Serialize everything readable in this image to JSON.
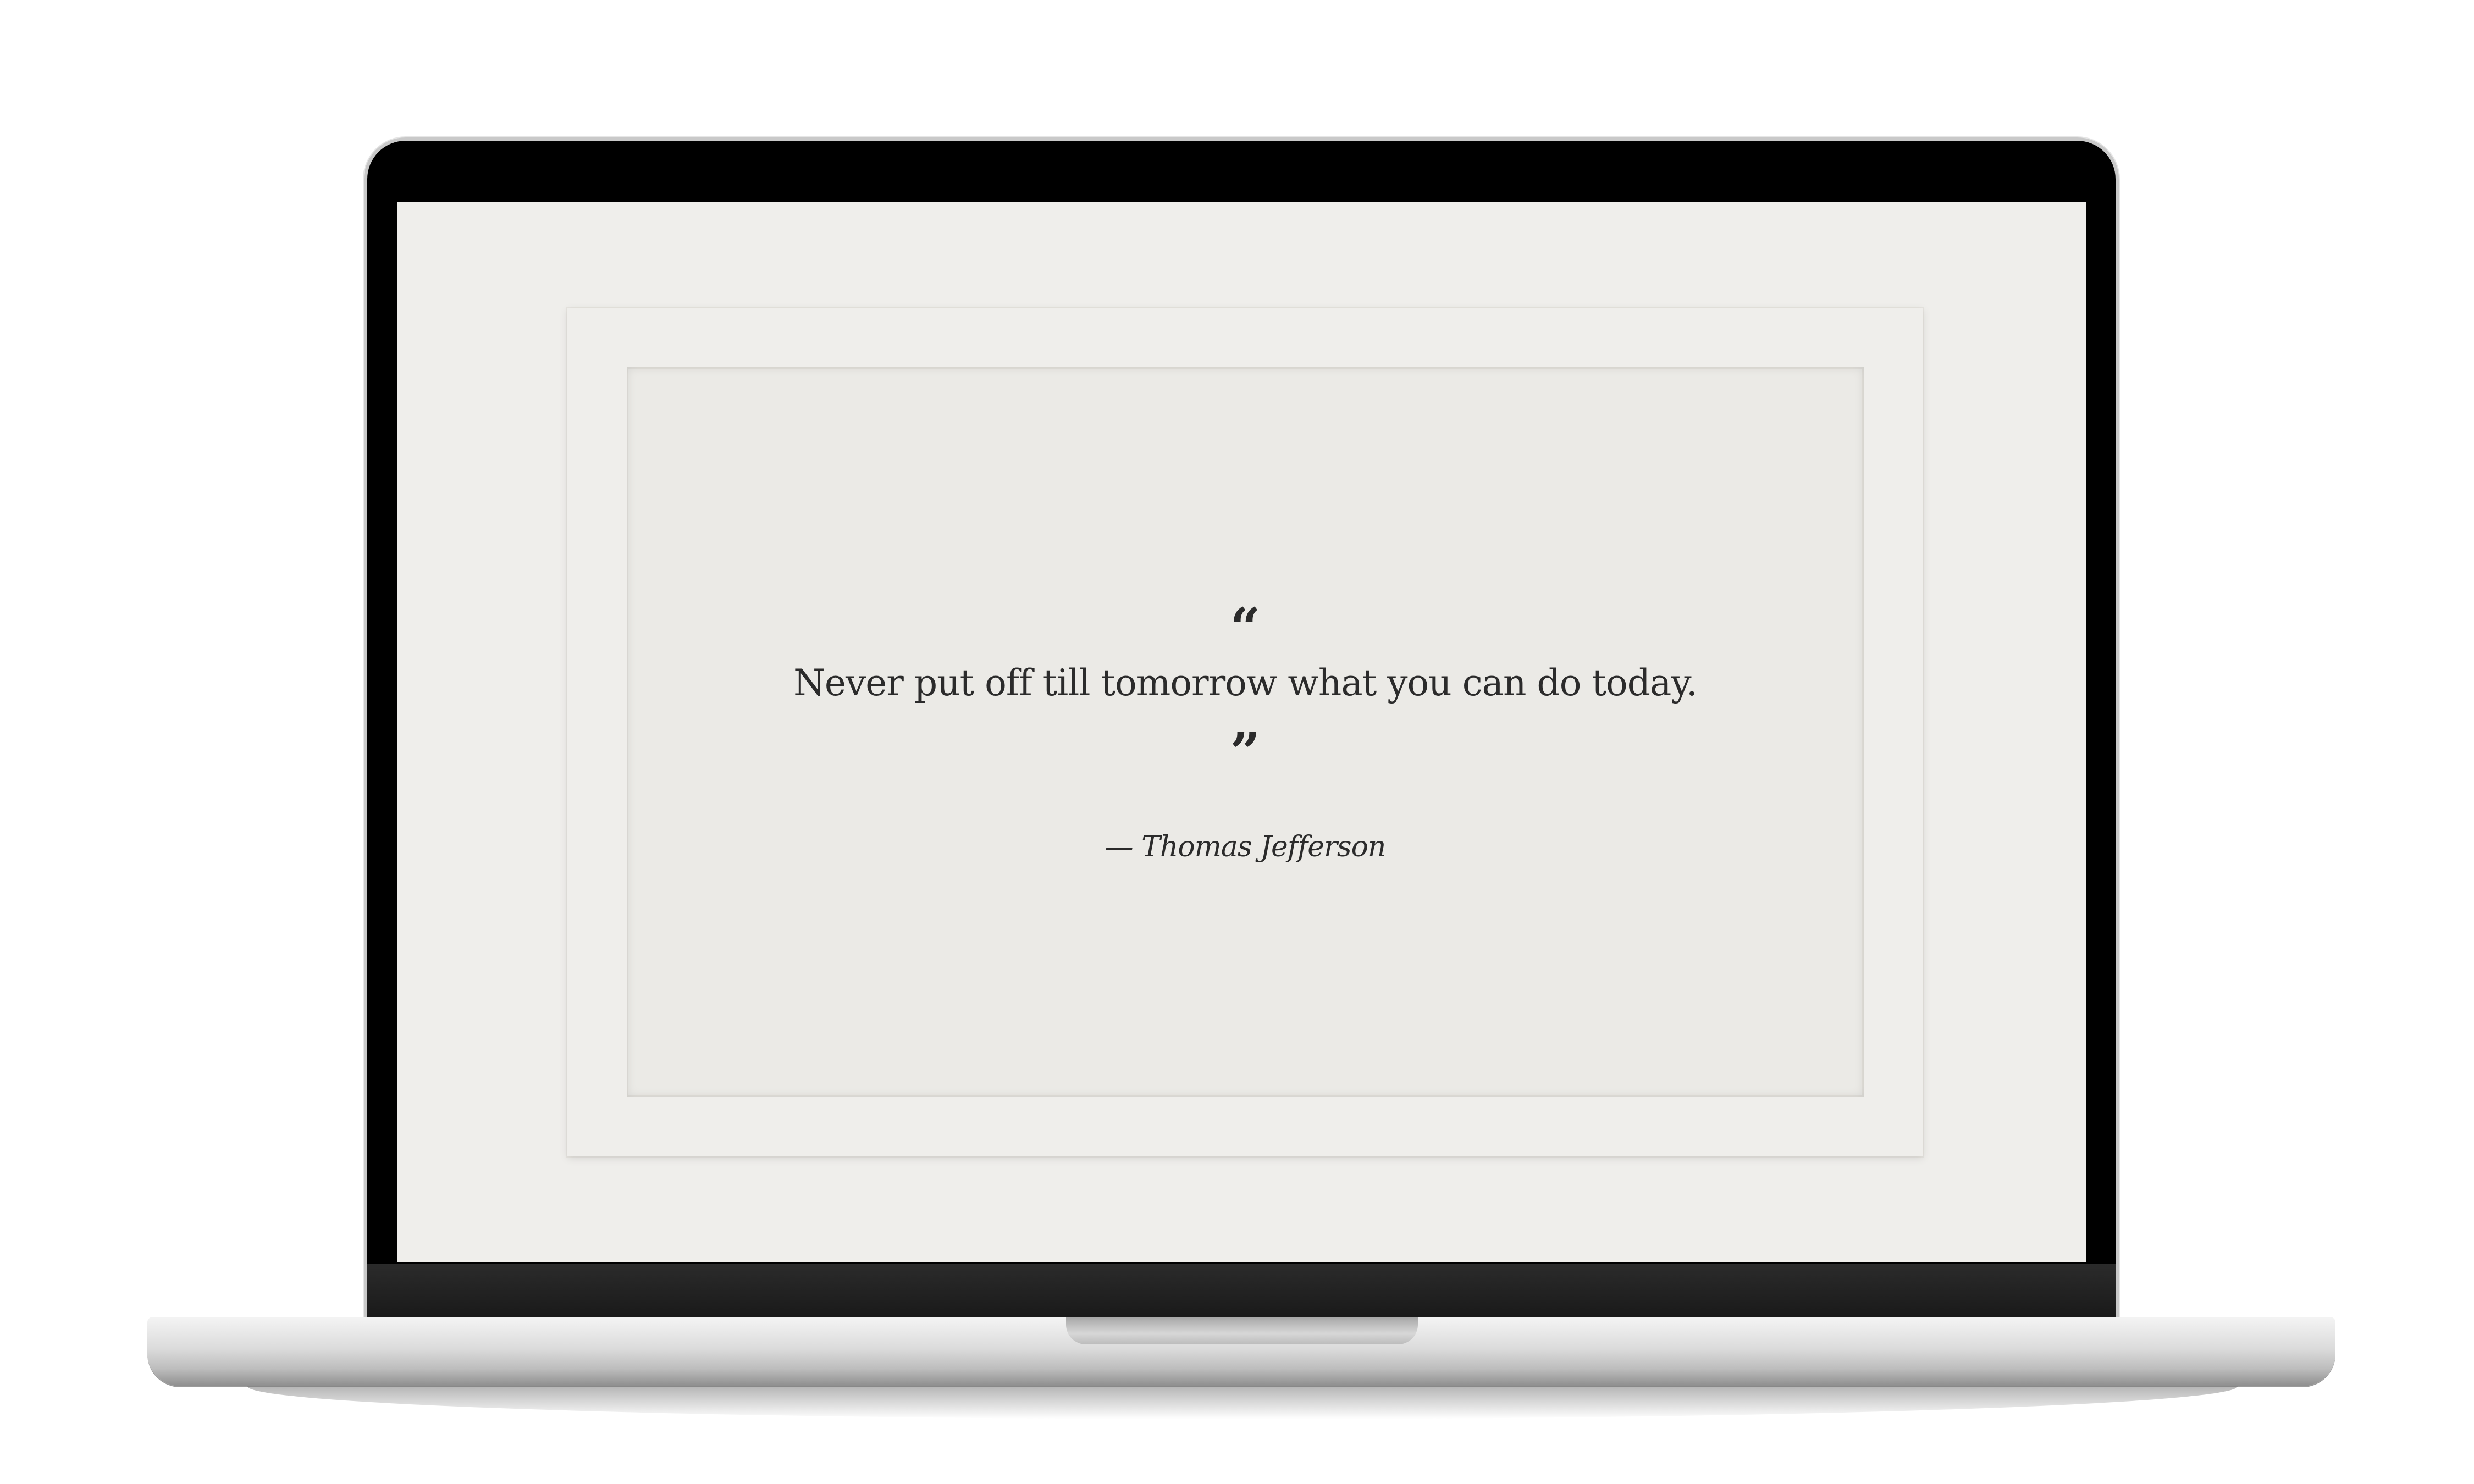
{
  "quote": {
    "open_mark": "“",
    "text": "Never put off till tomorrow what you can do today.",
    "close_mark": "”",
    "attribution": "— Thomas Jefferson"
  },
  "colors": {
    "screen_background": "#efeeeb",
    "card_background": "#ebeae6",
    "text": "#2b2b2b",
    "bezel": "#000000"
  }
}
